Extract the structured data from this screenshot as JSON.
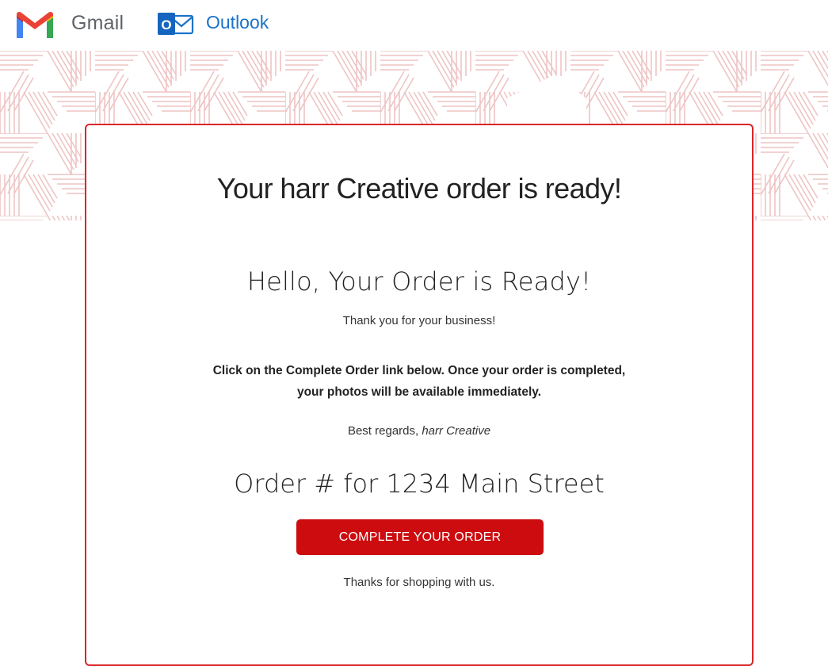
{
  "header": {
    "gmail_label": "Gmail",
    "outlook_label": "Outlook",
    "outlook_badge": "O"
  },
  "email": {
    "title": "Your harr Creative order is ready!",
    "greeting": "Hello, Your Order is Ready!",
    "thanks": "Thank you for your business!",
    "instructions_line1": "Click on the Complete Order link below. Once your order is completed,",
    "instructions_line2": "your photos will be available immediately.",
    "regards_prefix": "Best regards,",
    "regards_name": "harr Creative",
    "order_line": "Order # for 1234 Main Street",
    "cta_label": "COMPLETE YOUR ORDER",
    "closing": "Thanks for shopping with us."
  },
  "colors": {
    "accent_red": "#cc0c0f",
    "card_border": "#d9262a",
    "pattern_stroke": "#f0c9c9",
    "outlook_blue": "#1a73c9"
  },
  "icons": {
    "gmail": "gmail-logo-icon",
    "outlook": "outlook-logo-icon"
  }
}
